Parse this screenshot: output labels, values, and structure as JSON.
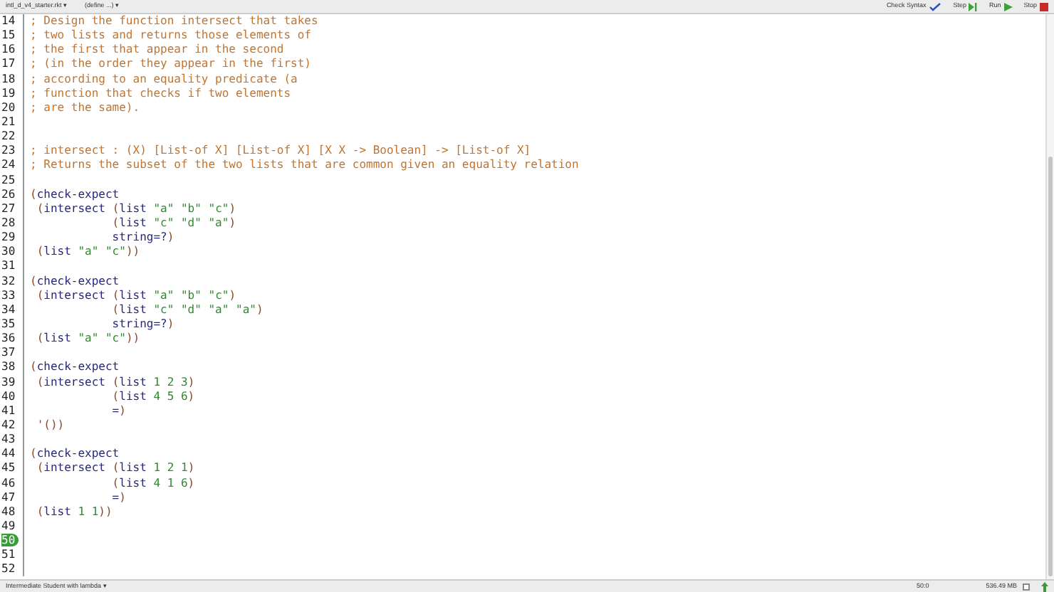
{
  "toolbar": {
    "file_menu": "intl_d_v4_starter.rkt ▾",
    "define_menu": "(define ...) ▾",
    "buttons": [
      {
        "kind": "check",
        "label": "Check Syntax"
      },
      {
        "kind": "step",
        "label": "Step"
      },
      {
        "kind": "run",
        "label": "Run"
      },
      {
        "kind": "stop",
        "label": "Stop"
      }
    ]
  },
  "editor": {
    "lines": [
      {
        "number": "14",
        "tokens": [
          {
            "kind": "comment",
            "text": "; Design the function intersect that takes"
          }
        ]
      },
      {
        "number": "15",
        "tokens": [
          {
            "kind": "comment",
            "text": "; two lists and returns those elements of"
          }
        ]
      },
      {
        "number": "16",
        "tokens": [
          {
            "kind": "comment",
            "text": "; the first that appear in the second"
          }
        ]
      },
      {
        "number": "17",
        "tokens": [
          {
            "kind": "comment",
            "text": "; (in the order they appear in the first)"
          }
        ]
      },
      {
        "number": "18",
        "tokens": [
          {
            "kind": "comment",
            "text": "; according to an equality predicate (a"
          }
        ]
      },
      {
        "number": "19",
        "tokens": [
          {
            "kind": "comment",
            "text": "; function that checks if two elements"
          }
        ]
      },
      {
        "number": "20",
        "tokens": [
          {
            "kind": "comment",
            "text": "; are the same)."
          }
        ]
      },
      {
        "number": "21"
      },
      {
        "number": "22"
      },
      {
        "number": "23",
        "tokens": [
          {
            "kind": "comment",
            "text": "; intersect : (X) [List-of X] [List-of X] [X X -> Boolean] -> [List-of X]"
          }
        ]
      },
      {
        "number": "24",
        "tokens": [
          {
            "kind": "comment",
            "text": "; Returns the subset of the two lists that are common given an equality relation"
          }
        ]
      },
      {
        "number": "25"
      },
      {
        "number": "26",
        "tokens": [
          {
            "kind": "paren",
            "text": "("
          },
          {
            "kind": "symbol",
            "text": "check-expect"
          }
        ]
      },
      {
        "number": "27",
        "tokens": [
          {
            "kind": "paren",
            "text": " ("
          },
          {
            "kind": "symbol",
            "text": "intersect"
          },
          {
            "kind": "paren",
            "text": " ("
          },
          {
            "kind": "symbol",
            "text": "list"
          },
          {
            "kind": "string",
            "text": " \"a\" \"b\" \"c\""
          },
          {
            "kind": "paren",
            "text": ")"
          }
        ]
      },
      {
        "number": "28",
        "tokens": [
          {
            "kind": "paren",
            "text": "            ("
          },
          {
            "kind": "symbol",
            "text": "list"
          },
          {
            "kind": "string",
            "text": " \"c\" \"d\" \"a\""
          },
          {
            "kind": "paren",
            "text": ")"
          }
        ]
      },
      {
        "number": "29",
        "tokens": [
          {
            "kind": "symbol",
            "text": "            string=?"
          },
          {
            "kind": "paren",
            "text": ")"
          }
        ]
      },
      {
        "number": "30",
        "tokens": [
          {
            "kind": "paren",
            "text": " ("
          },
          {
            "kind": "symbol",
            "text": "list"
          },
          {
            "kind": "string",
            "text": " \"a\" \"c\""
          },
          {
            "kind": "paren",
            "text": "))"
          }
        ]
      },
      {
        "number": "31"
      },
      {
        "number": "32",
        "tokens": [
          {
            "kind": "paren",
            "text": "("
          },
          {
            "kind": "symbol",
            "text": "check-expect"
          }
        ]
      },
      {
        "number": "33",
        "tokens": [
          {
            "kind": "paren",
            "text": " ("
          },
          {
            "kind": "symbol",
            "text": "intersect"
          },
          {
            "kind": "paren",
            "text": " ("
          },
          {
            "kind": "symbol",
            "text": "list"
          },
          {
            "kind": "string",
            "text": " \"a\" \"b\" \"c\""
          },
          {
            "kind": "paren",
            "text": ")"
          }
        ]
      },
      {
        "number": "34",
        "tokens": [
          {
            "kind": "paren",
            "text": "            ("
          },
          {
            "kind": "symbol",
            "text": "list"
          },
          {
            "kind": "string",
            "text": " \"c\" \"d\" \"a\" \"a\""
          },
          {
            "kind": "paren",
            "text": ")"
          }
        ]
      },
      {
        "number": "35",
        "tokens": [
          {
            "kind": "symbol",
            "text": "            string=?"
          },
          {
            "kind": "paren",
            "text": ")"
          }
        ]
      },
      {
        "number": "36",
        "tokens": [
          {
            "kind": "paren",
            "text": " ("
          },
          {
            "kind": "symbol",
            "text": "list"
          },
          {
            "kind": "string",
            "text": " \"a\" \"c\""
          },
          {
            "kind": "paren",
            "text": "))"
          }
        ]
      },
      {
        "number": "37"
      },
      {
        "number": "38",
        "tokens": [
          {
            "kind": "paren",
            "text": "("
          },
          {
            "kind": "symbol",
            "text": "check-expect"
          }
        ]
      },
      {
        "number": "39",
        "tokens": [
          {
            "kind": "paren",
            "text": " ("
          },
          {
            "kind": "symbol",
            "text": "intersect"
          },
          {
            "kind": "paren",
            "text": " ("
          },
          {
            "kind": "symbol",
            "text": "list"
          },
          {
            "kind": "number",
            "text": " 1 2 3"
          },
          {
            "kind": "paren",
            "text": ")"
          }
        ]
      },
      {
        "number": "40",
        "tokens": [
          {
            "kind": "paren",
            "text": "            ("
          },
          {
            "kind": "symbol",
            "text": "list"
          },
          {
            "kind": "number",
            "text": " 4 5 6"
          },
          {
            "kind": "paren",
            "text": ")"
          }
        ]
      },
      {
        "number": "41",
        "tokens": [
          {
            "kind": "symbol",
            "text": "            ="
          },
          {
            "kind": "paren",
            "text": ")"
          }
        ]
      },
      {
        "number": "42",
        "tokens": [
          {
            "kind": "paren",
            "text": " '())"
          }
        ]
      },
      {
        "number": "43"
      },
      {
        "number": "44",
        "tokens": [
          {
            "kind": "paren",
            "text": "("
          },
          {
            "kind": "symbol",
            "text": "check-expect"
          }
        ]
      },
      {
        "number": "45",
        "tokens": [
          {
            "kind": "paren",
            "text": " ("
          },
          {
            "kind": "symbol",
            "text": "intersect"
          },
          {
            "kind": "paren",
            "text": " ("
          },
          {
            "kind": "symbol",
            "text": "list"
          },
          {
            "kind": "number",
            "text": " 1 2 1"
          },
          {
            "kind": "paren",
            "text": ")"
          }
        ]
      },
      {
        "number": "46",
        "tokens": [
          {
            "kind": "paren",
            "text": "            ("
          },
          {
            "kind": "symbol",
            "text": "list"
          },
          {
            "kind": "number",
            "text": " 4 1 6"
          },
          {
            "kind": "paren",
            "text": ")"
          }
        ]
      },
      {
        "number": "47",
        "tokens": [
          {
            "kind": "symbol",
            "text": "            ="
          },
          {
            "kind": "paren",
            "text": ")"
          }
        ]
      },
      {
        "number": "48",
        "tokens": [
          {
            "kind": "paren",
            "text": " ("
          },
          {
            "kind": "symbol",
            "text": "list"
          },
          {
            "kind": "number",
            "text": " 1 1"
          },
          {
            "kind": "paren",
            "text": "))"
          }
        ]
      },
      {
        "number": "49"
      },
      {
        "number": "50",
        "current": true
      },
      {
        "number": "51"
      },
      {
        "number": "52"
      }
    ]
  },
  "status_bar": {
    "language": "Intermediate Student with lambda ▾",
    "position": "50:0",
    "memory": "536.49 MB",
    "checkbox": {
      "checked": false
    }
  }
}
